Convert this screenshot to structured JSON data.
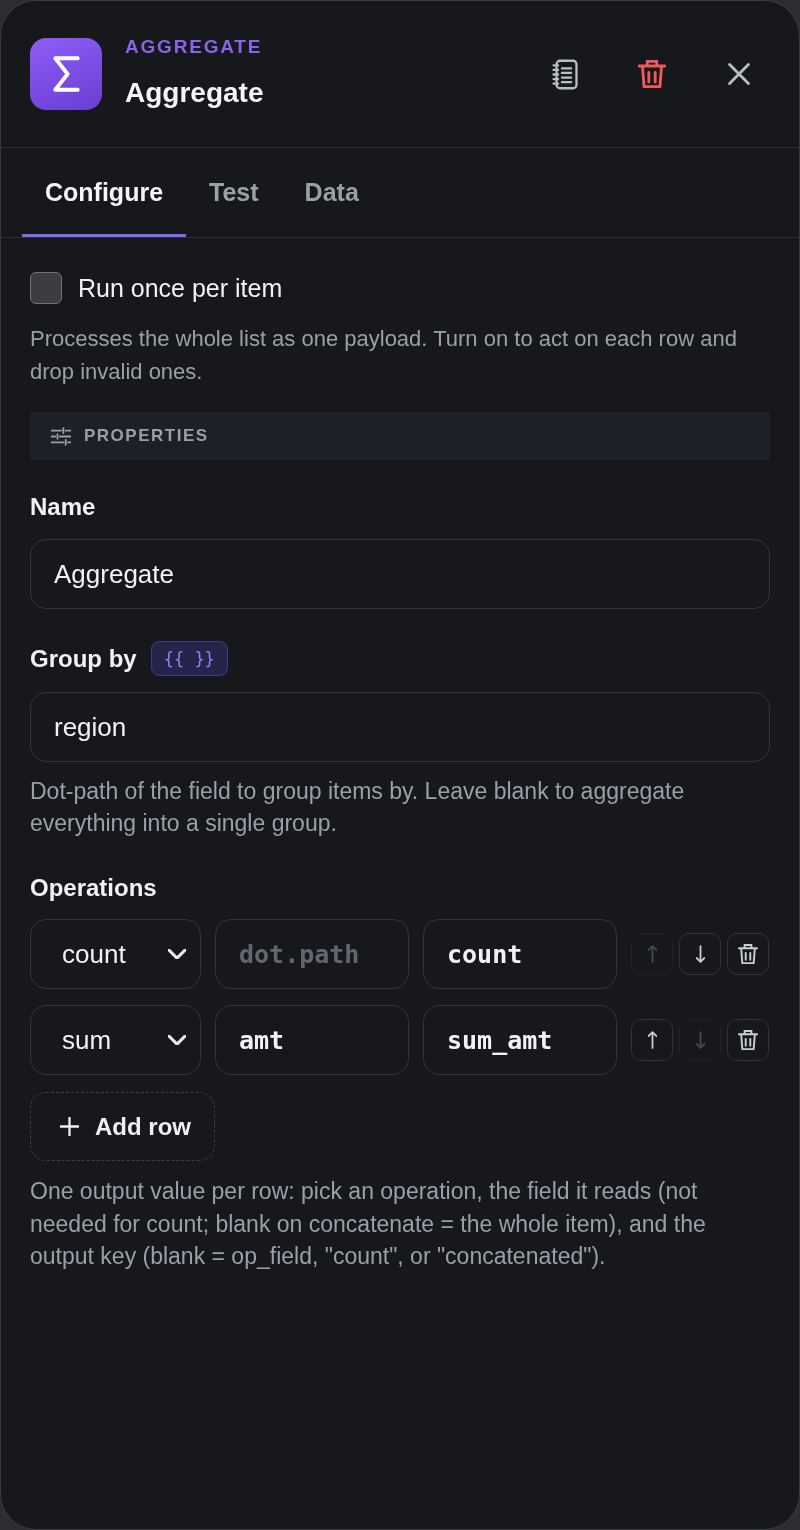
{
  "header": {
    "kicker": "AGGREGATE",
    "title": "Aggregate"
  },
  "tabs": [
    {
      "label": "Configure",
      "selected": true
    },
    {
      "label": "Test",
      "selected": false
    },
    {
      "label": "Data",
      "selected": false
    }
  ],
  "run_once": {
    "label": "Run once per item",
    "checked": false,
    "description": "Processes the whole list as one payload. Turn on to act on each row and drop invalid ones."
  },
  "section": {
    "title": "PROPERTIES"
  },
  "fields": [
    {
      "label": "Name",
      "value": "Aggregate"
    },
    {
      "label": "Group by",
      "badge": "{{ }}",
      "value": "region",
      "help": "Dot-path of the field to group items by. Leave blank to aggregate everything into a single group."
    }
  ],
  "operations": {
    "label": "Operations",
    "rows": [
      {
        "operation": "count",
        "field_placeholder": "dot.path",
        "output": "count",
        "up_disabled": true,
        "down_disabled": false
      },
      {
        "operation": "sum",
        "field": "amt",
        "output": "sum_amt",
        "up_disabled": false,
        "down_disabled": true
      }
    ],
    "add_label": "Add row",
    "help": "One output value per row: pick an operation, the field it reads (not needed for count; blank on concatenate = the whole item), and the output key (blank = op_field, \"count\", or \"concatenated\")."
  }
}
